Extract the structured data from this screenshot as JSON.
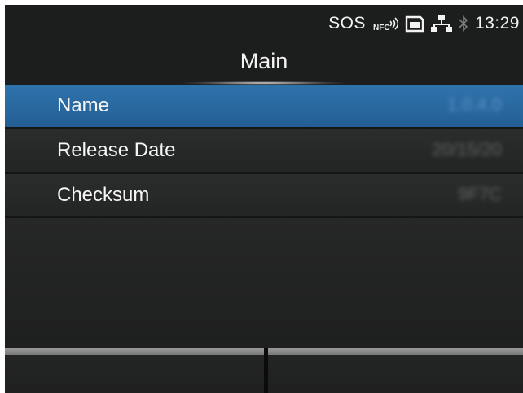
{
  "status_bar": {
    "sos_text": "SOS",
    "nfc_label": "NFC",
    "time": "13:29",
    "icons": [
      "nfc-icon",
      "sd-card-icon",
      "network-icon",
      "bluetooth-icon"
    ]
  },
  "header": {
    "title": "Main"
  },
  "menu": {
    "items": [
      {
        "label": "Name",
        "value": "1.0.4.0",
        "selected": true
      },
      {
        "label": "Release Date",
        "value": "20/15/20",
        "selected": false
      },
      {
        "label": "Checksum",
        "value": "9F7C",
        "selected": false
      }
    ]
  },
  "softkeys": {
    "left_label": "",
    "right_label": ""
  },
  "colors": {
    "screen_background": "#262727",
    "selected_row": "#2a6aa3",
    "row_background": "#282a29",
    "text": "#f4f4f4"
  }
}
